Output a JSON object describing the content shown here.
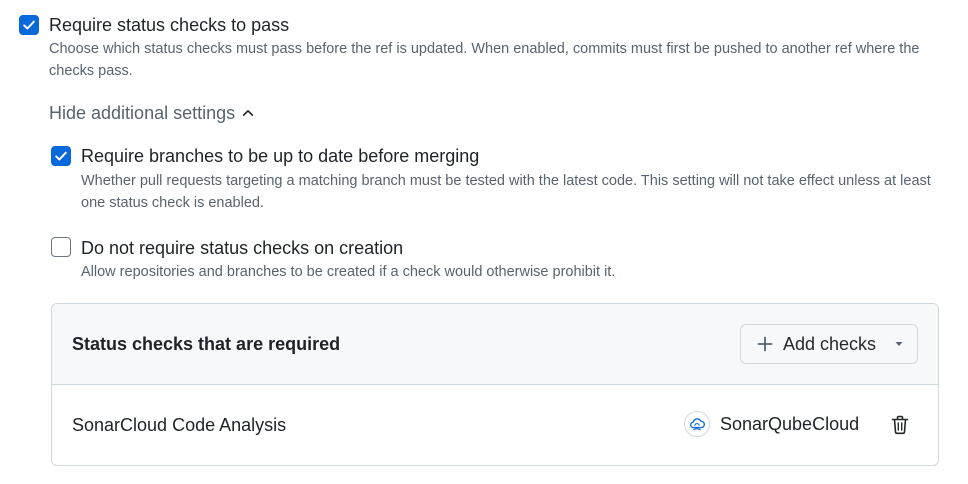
{
  "require_status_checks": {
    "label": "Require status checks to pass",
    "description": "Choose which status checks must pass before the ref is updated. When enabled, commits must first be pushed to another ref where the checks pass.",
    "checked": true
  },
  "toggle": {
    "label": "Hide additional settings",
    "icon": "chevron-up-icon"
  },
  "up_to_date": {
    "label": "Require branches to be up to date before merging",
    "description": "Whether pull requests targeting a matching branch must be tested with the latest code. This setting will not take effect unless at least one status check is enabled.",
    "checked": true
  },
  "on_creation": {
    "label": "Do not require status checks on creation",
    "description": "Allow repositories and branches to be created if a check would otherwise prohibit it.",
    "checked": false
  },
  "status_checks_panel": {
    "title": "Status checks that are required",
    "add_button_label": "Add checks",
    "checks": [
      {
        "name": "SonarCloud Code Analysis",
        "app_name": "SonarQubeCloud",
        "app_icon": "sonarqubecloud-logo-icon"
      }
    ]
  },
  "colors": {
    "accent": "#0969da",
    "muted_text": "#59636e",
    "border": "#d1d9e0",
    "panel_header_bg": "#f6f8fa"
  }
}
